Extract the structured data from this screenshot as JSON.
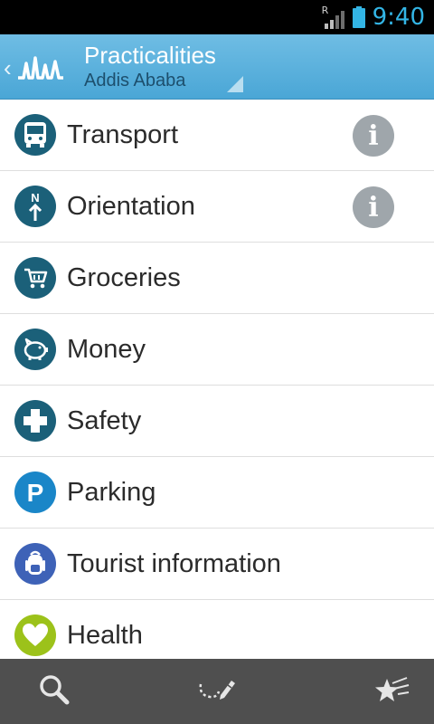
{
  "status_bar": {
    "signal_badge": "R",
    "time": "9:40",
    "clock_color": "#33b5e5"
  },
  "action_bar": {
    "title": "Practicalities",
    "subtitle": "Addis Ababa",
    "background_color": "#5cb2de",
    "icons": [
      "back-chevron-icon",
      "app-logo-icon",
      "dropdown-triangle-icon"
    ]
  },
  "list": {
    "items": [
      {
        "label": "Transport",
        "icon": "bus-icon",
        "color": "#1b6079",
        "info": true
      },
      {
        "label": "Orientation",
        "icon": "north-arrow-icon",
        "color": "#1b6079",
        "info": true
      },
      {
        "label": "Groceries",
        "icon": "shopping-cart-icon",
        "color": "#1b6079",
        "info": false
      },
      {
        "label": "Money",
        "icon": "piggy-bank-icon",
        "color": "#1b6079",
        "info": false
      },
      {
        "label": "Safety",
        "icon": "plus-cross-icon",
        "color": "#1b6079",
        "info": false
      },
      {
        "label": "Parking",
        "icon": "parking-p-icon",
        "color": "#1a86c8",
        "info": false
      },
      {
        "label": "Tourist information",
        "icon": "backpack-icon",
        "color": "#3e62b7",
        "info": false
      },
      {
        "label": "Health",
        "icon": "heart-icon",
        "color": "#9cc21a",
        "info": false
      }
    ],
    "info_icon": "info-icon",
    "info_glyph": "i"
  },
  "bottom_bar": {
    "buttons": [
      "search-icon",
      "edit-route-icon",
      "favorites-stars-icon"
    ]
  }
}
